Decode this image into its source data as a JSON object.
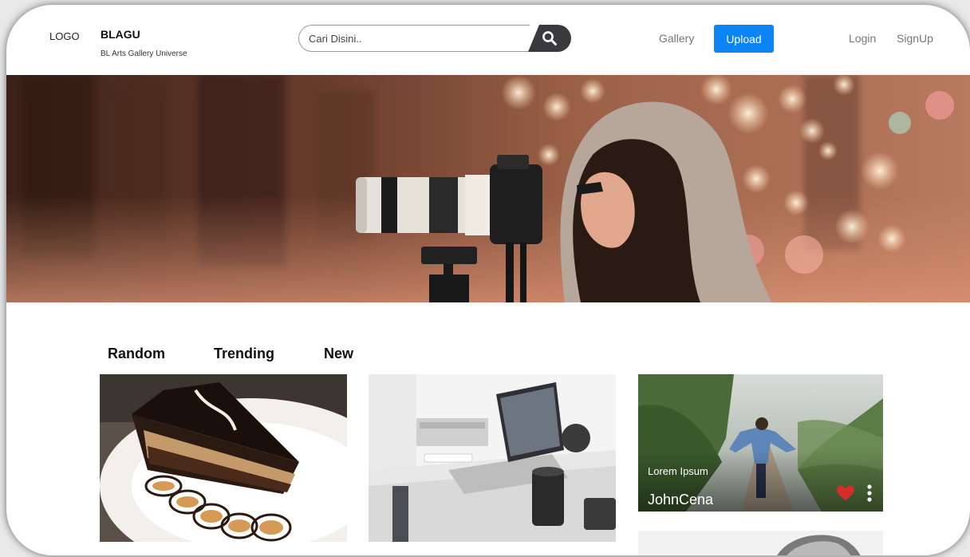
{
  "header": {
    "logo": "LOGO",
    "brand_title": "BLAGU",
    "brand_subtitle": "BL Arts Gallery Universe",
    "search_placeholder": "Cari Disini..",
    "nav": {
      "gallery": "Gallery",
      "upload": "Upload",
      "login": "Login",
      "signup": "SignUp"
    }
  },
  "tabs": [
    "Random",
    "Trending",
    "New"
  ],
  "featured_card": {
    "caption": "Lorem Ipsum",
    "author": "JohnCena"
  },
  "icons": {
    "search": "search-icon",
    "heart": "heart-icon",
    "more": "more-vertical-icon"
  },
  "colors": {
    "accent": "#0d84f4",
    "search_button": "#3a3a3c",
    "heart": "#d62b2b"
  }
}
